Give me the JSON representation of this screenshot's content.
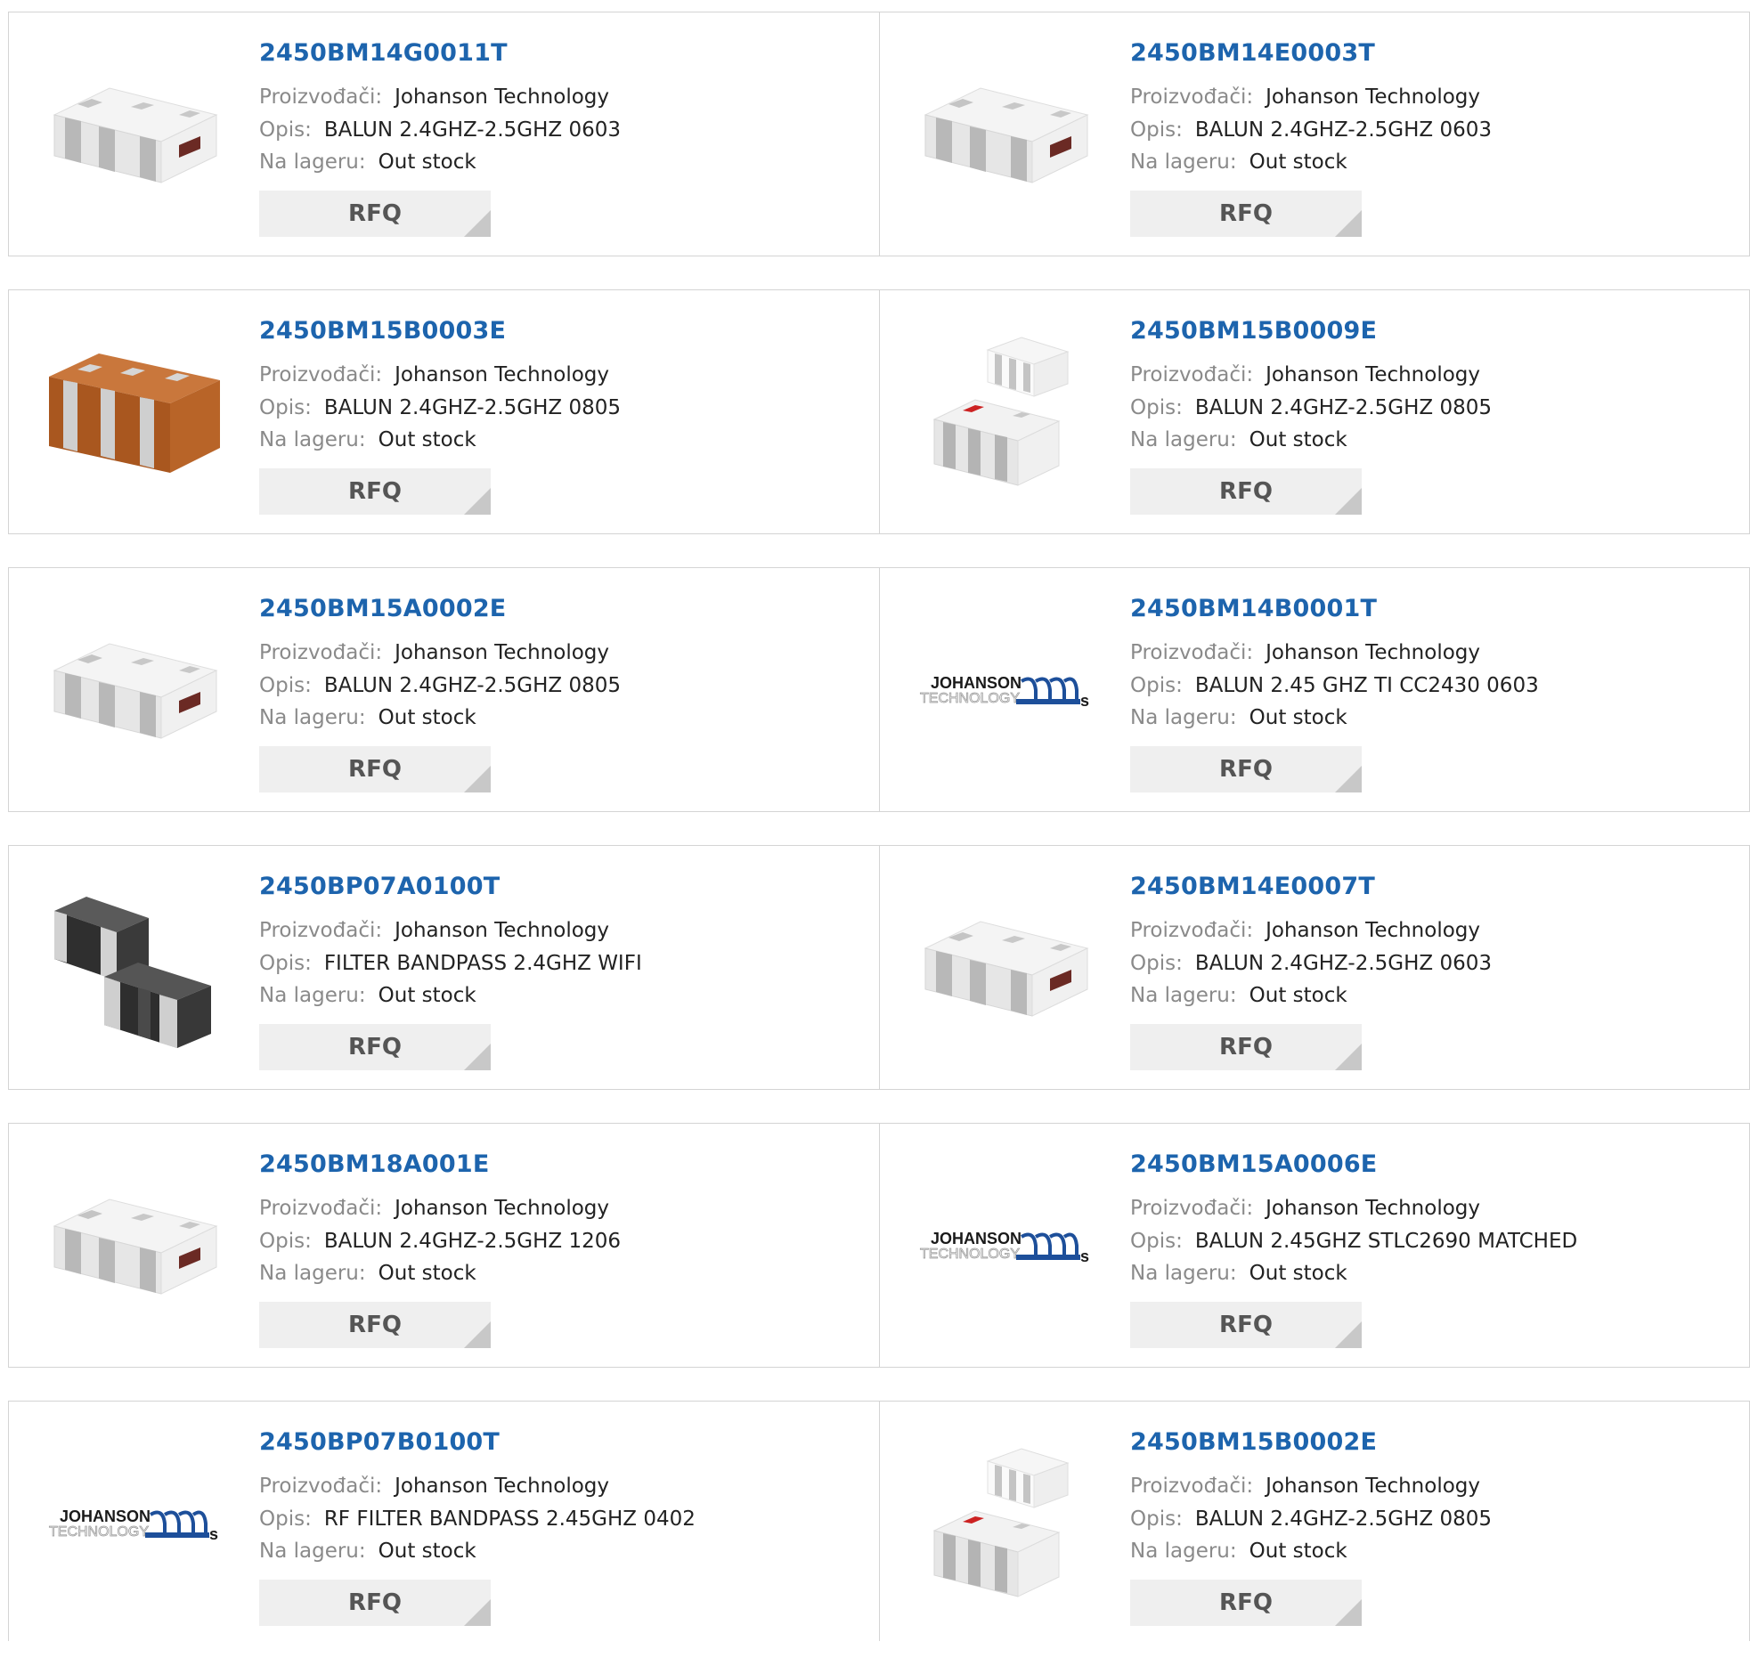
{
  "labels": {
    "manufacturer": "Proizvođači:",
    "description": "Opis:",
    "stock": "Na lageru:",
    "rfq": "RFQ"
  },
  "products": [
    {
      "part": "2450BM14G0011T",
      "manufacturer": "Johanson Technology",
      "description": "BALUN 2.4GHZ-2.5GHZ 0603",
      "stock": "Out stock",
      "image": "chip-white-balun"
    },
    {
      "part": "2450BM14E0003T",
      "manufacturer": "Johanson Technology",
      "description": "BALUN 2.4GHZ-2.5GHZ 0603",
      "stock": "Out stock",
      "image": "chip-white-balun"
    },
    {
      "part": "2450BM15B0003E",
      "manufacturer": "Johanson Technology",
      "description": "BALUN 2.4GHZ-2.5GHZ 0805",
      "stock": "Out stock",
      "image": "chip-orange"
    },
    {
      "part": "2450BM15B0009E",
      "manufacturer": "Johanson Technology",
      "description": "BALUN 2.4GHZ-2.5GHZ 0805",
      "stock": "Out stock",
      "image": "chip-pair-white"
    },
    {
      "part": "2450BM15A0002E",
      "manufacturer": "Johanson Technology",
      "description": "BALUN 2.4GHZ-2.5GHZ 0805",
      "stock": "Out stock",
      "image": "chip-white-balun"
    },
    {
      "part": "2450BM14B0001T",
      "manufacturer": "Johanson Technology",
      "description": "BALUN 2.45 GHZ TI CC2430 0603",
      "stock": "Out stock",
      "image": "johanson-logo"
    },
    {
      "part": "2450BP07A0100T",
      "manufacturer": "Johanson Technology",
      "description": "FILTER BANDPASS 2.4GHZ WIFI",
      "stock": "Out stock",
      "image": "chip-dark-filter"
    },
    {
      "part": "2450BM14E0007T",
      "manufacturer": "Johanson Technology",
      "description": "BALUN 2.4GHZ-2.5GHZ 0603",
      "stock": "Out stock",
      "image": "chip-white-balun"
    },
    {
      "part": "2450BM18A001E",
      "manufacturer": "Johanson Technology",
      "description": "BALUN 2.4GHZ-2.5GHZ 1206",
      "stock": "Out stock",
      "image": "chip-white-balun"
    },
    {
      "part": "2450BM15A0006E",
      "manufacturer": "Johanson Technology",
      "description": "BALUN 2.45GHZ STLC2690 MATCHED",
      "stock": "Out stock",
      "image": "johanson-logo"
    },
    {
      "part": "2450BP07B0100T",
      "manufacturer": "Johanson Technology",
      "description": "RF FILTER BANDPASS 2.45GHZ 0402",
      "stock": "Out stock",
      "image": "johanson-logo"
    },
    {
      "part": "2450BM15B0002E",
      "manufacturer": "Johanson Technology",
      "description": "BALUN 2.4GHZ-2.5GHZ 0805",
      "stock": "Out stock",
      "image": "chip-pair-white"
    }
  ],
  "logo": {
    "line1": "JOHANSON",
    "line2": "TECHNOLOGY"
  },
  "colors": {
    "link": "#1d64ad",
    "label": "#8a8a8a",
    "button_bg": "#efefef"
  }
}
